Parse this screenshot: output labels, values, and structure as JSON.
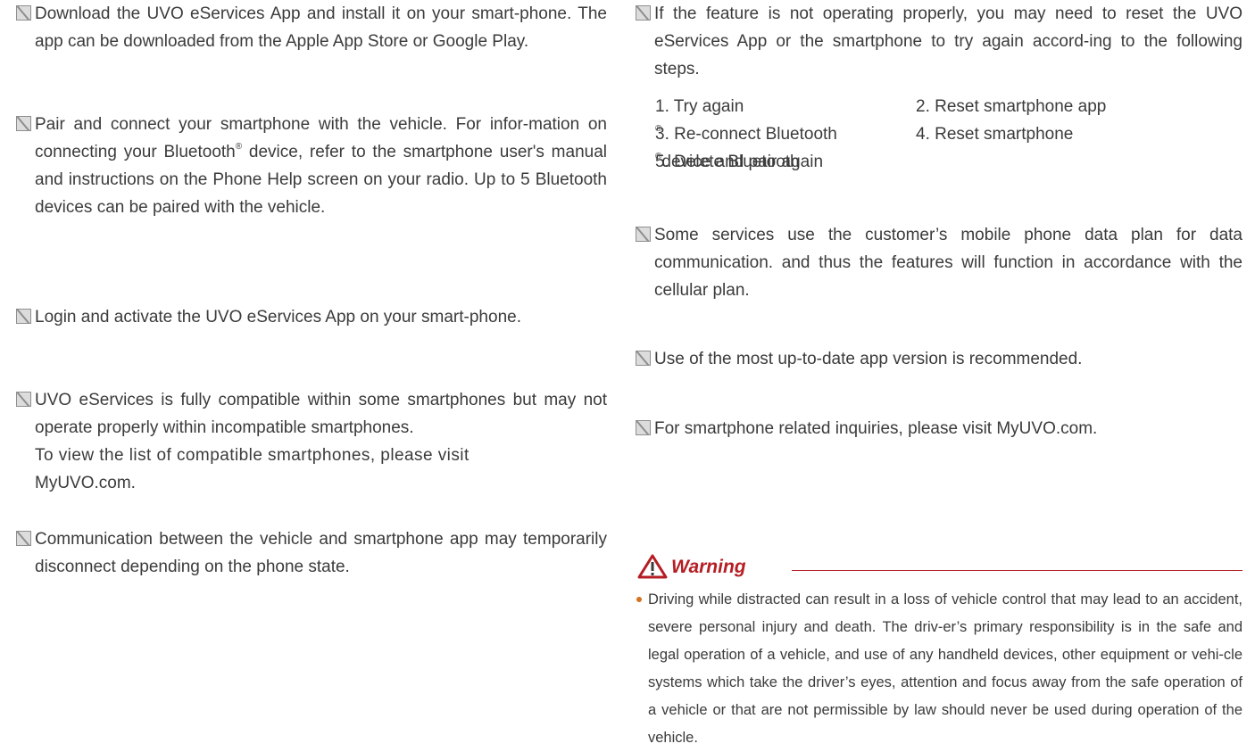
{
  "left": {
    "note1": "Download the UVO eServices App and install it on your smart-phone. The app can be downloaded from the Apple App Store or Google Play.",
    "note2_a": "Pair and connect your smartphone with the vehicle. For infor-mation on connecting your Bluetooth",
    "note2_b": " device, refer to the smartphone user's manual and instructions on the Phone Help screen on your radio. Up to 5 Bluetooth devices can be paired with the vehicle.",
    "note3": "Login and activate the UVO eServices App on your smart-phone.",
    "note4_a": "UVO eServices is fully compatible within some smartphones but may not operate properly within incompatible smartphones.",
    "note4_b": "To view the list of compatible smartphones, please visit",
    "note4_c": "MyUVO.com.",
    "note5": "Communication between the vehicle and smartphone app may temporarily disconnect depending on the phone state."
  },
  "right": {
    "note1": "If the feature is not operating properly, you may need to reset the UVO eServices App or the smartphone to try again accord-ing to the following steps.",
    "steps": {
      "s1": "1. Try again",
      "s2": "2. Reset smartphone app",
      "s3": "3. Re-connect Bluetooth",
      "s4": "4. Reset smartphone",
      "s5a": "5. Delete Bluetooth",
      "s5b": " device and pair again"
    },
    "note2": "Some services use the customer’s mobile phone data plan for data communication. and thus the features will function in accordance with the cellular plan.",
    "note3": "Use of the most up-to-date app version is recommended.",
    "note4": "For smartphone related inquiries, please visit MyUVO.com.",
    "warning": {
      "title": "Warning",
      "text": "Driving while distracted can result in a loss of vehicle control that may lead to an accident, severe personal injury and death. The driv-er’s primary responsibility is in the safe and legal operation of a vehicle, and use of any handheld devices, other equipment or vehi-cle systems which take the driver’s eyes, attention and focus away from the safe operation of a vehicle or that are not permissible by law should never be used during operation of the vehicle."
    }
  },
  "symbols": {
    "registered": "®"
  },
  "colors": {
    "warning": "#b41e24",
    "bullet": "#d4721e",
    "text": "#3b3b3b"
  },
  "icons": {
    "note": "note-icon",
    "warning": "warning-triangle-icon"
  }
}
